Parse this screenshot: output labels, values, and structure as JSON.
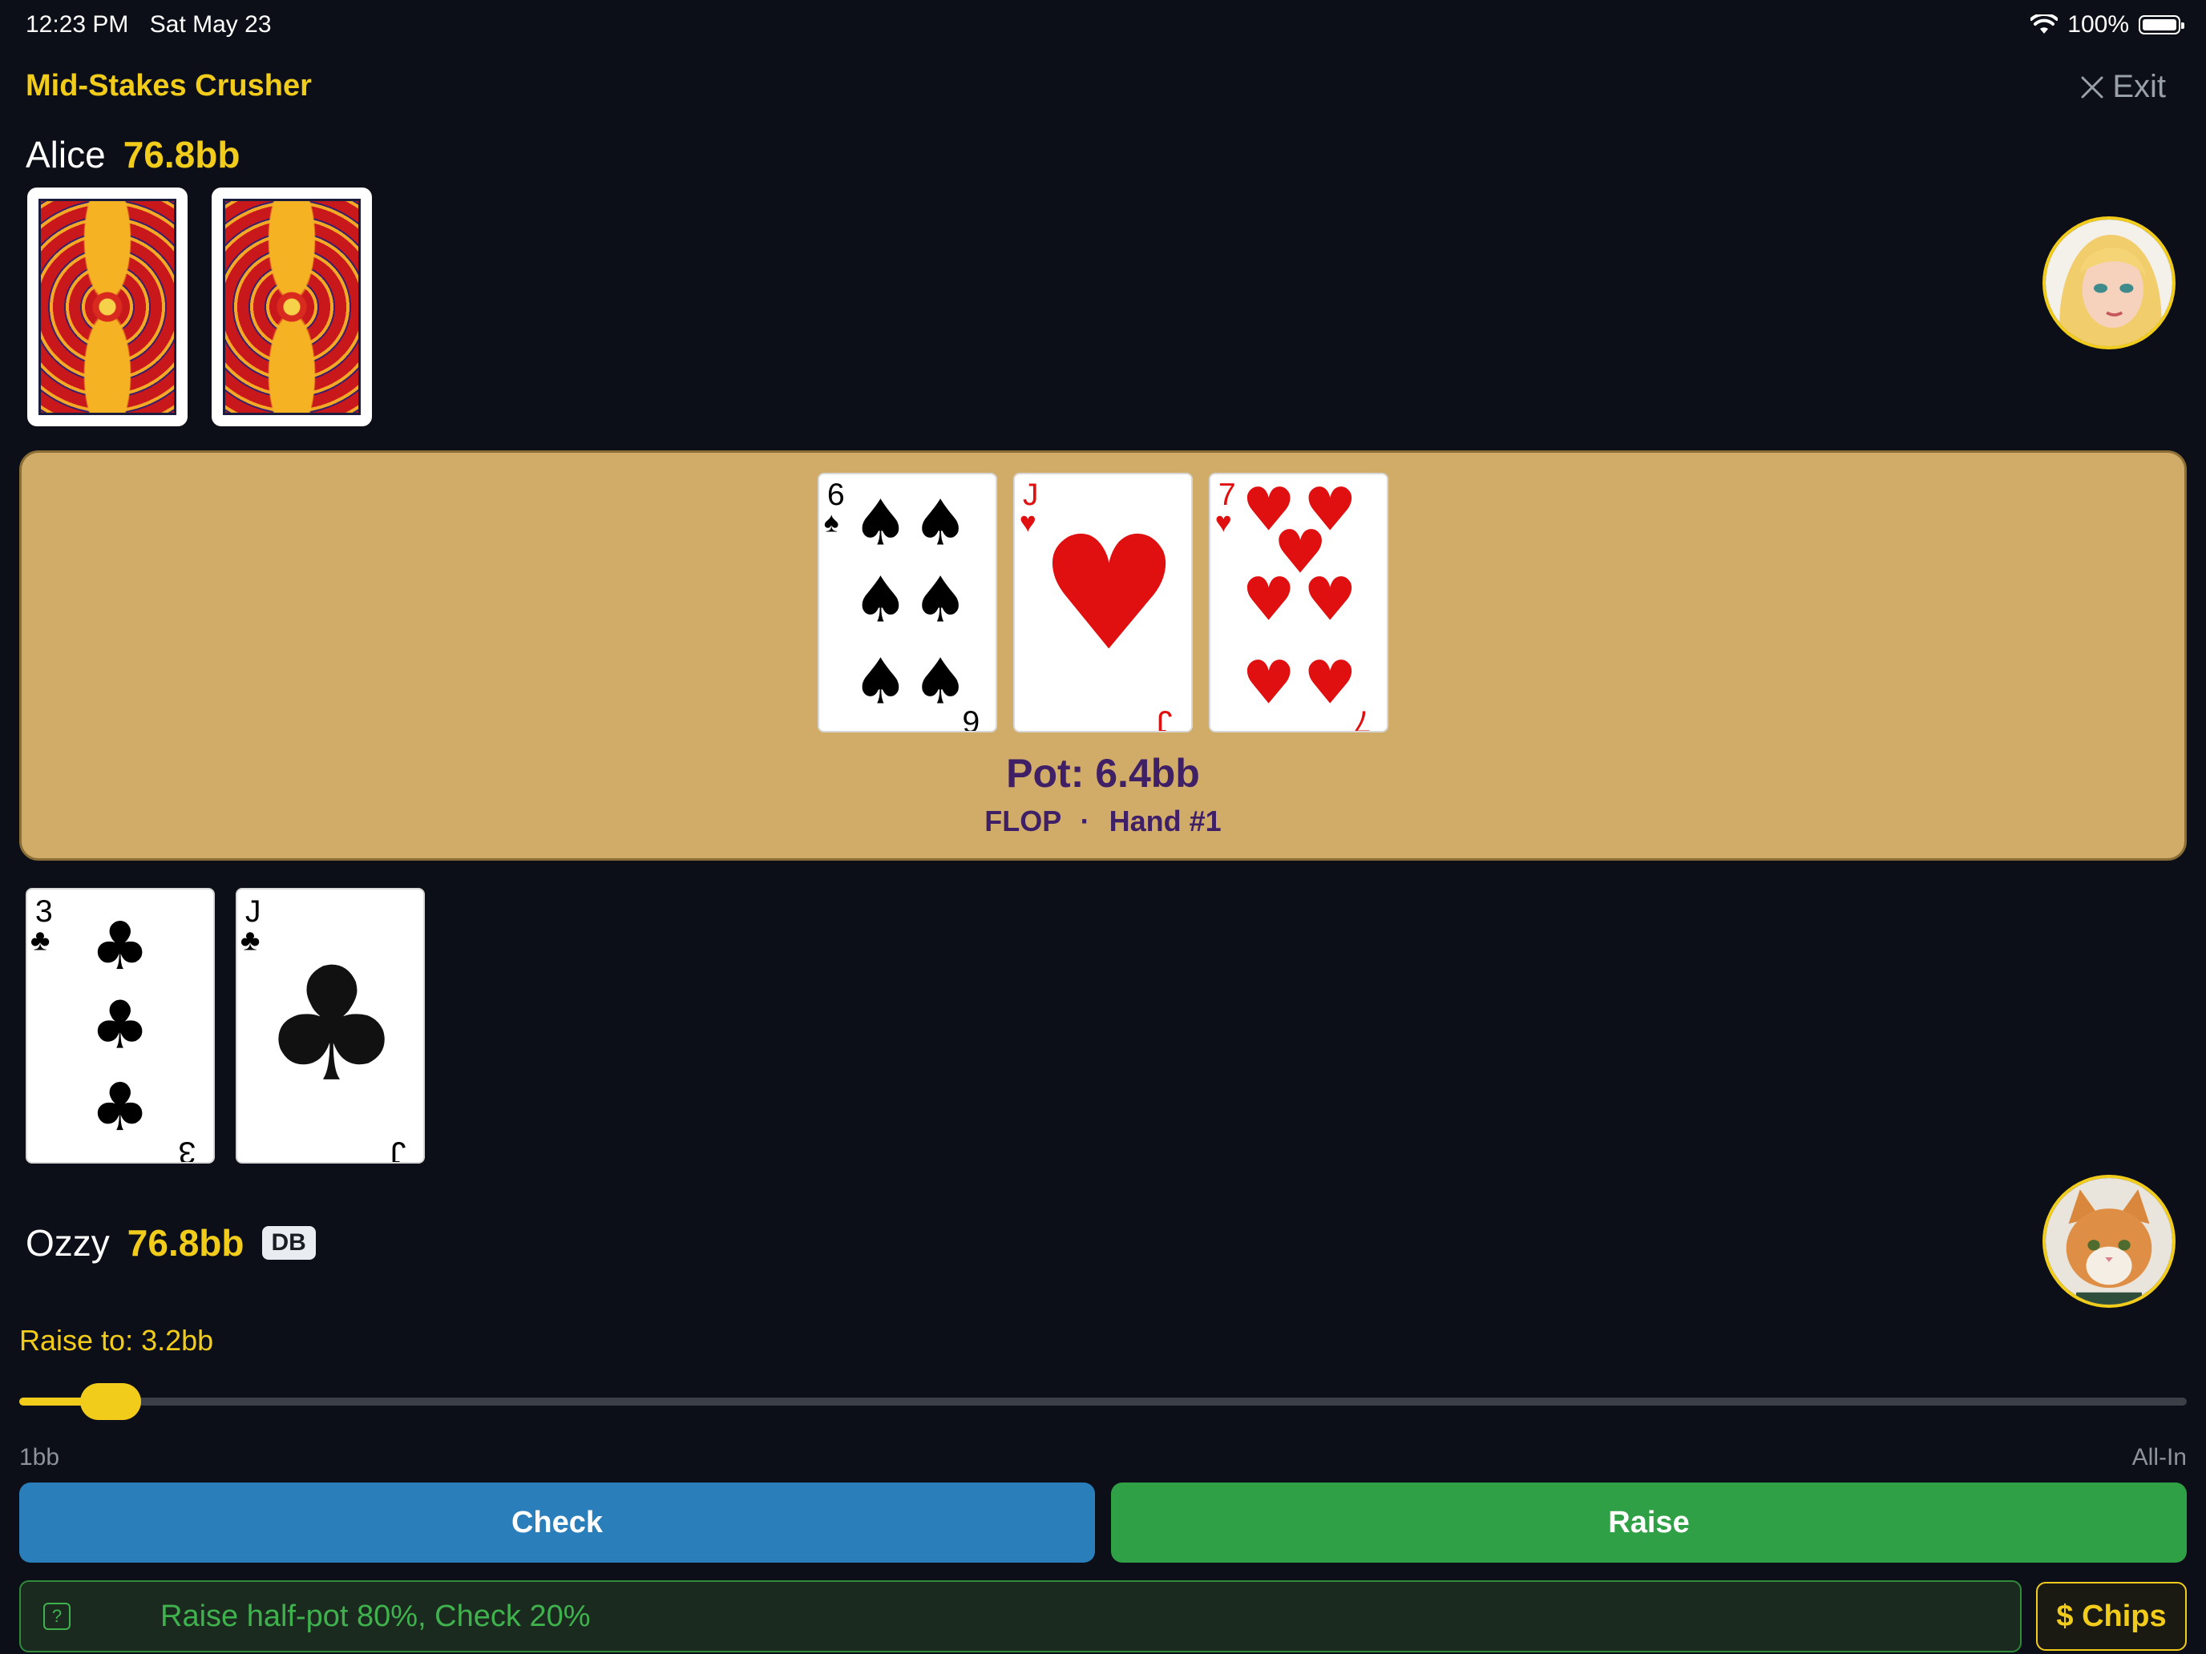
{
  "status_bar": {
    "time": "12:23 PM",
    "date": "Sat May 23",
    "battery": "100%",
    "wifi_icon": "wifi-icon",
    "battery_icon": "battery-icon"
  },
  "header": {
    "title": "Mid-Stakes Crusher",
    "exit_label": "Exit",
    "exit_icon": "close-icon"
  },
  "opponent": {
    "name": "Alice",
    "stack": "76.8bb",
    "avatar": "alice-avatar",
    "hole_cards": [
      "back",
      "back"
    ]
  },
  "board": {
    "cards": [
      {
        "rank": "6",
        "suit": "♠",
        "color": "#000000"
      },
      {
        "rank": "J",
        "suit": "♥",
        "color": "#e01010"
      },
      {
        "rank": "7",
        "suit": "♥",
        "color": "#e01010"
      }
    ],
    "pot": "Pot: 6.4bb",
    "street": "FLOP",
    "separator": "·",
    "hand": "Hand #1"
  },
  "hero": {
    "name": "Ozzy",
    "stack": "76.8bb",
    "badge": "DB",
    "avatar": "ozzy-avatar",
    "hole_cards": [
      {
        "rank": "3",
        "suit": "♣",
        "color": "#000000"
      },
      {
        "rank": "J",
        "suit": "♣",
        "color": "#000000"
      }
    ]
  },
  "raise": {
    "label": "Raise to: 3.2bb",
    "min_label": "1bb",
    "max_label": "All-In",
    "slider_fraction": 0.03
  },
  "actions": {
    "check_label": "Check",
    "raise_label": "Raise"
  },
  "advice": {
    "icon": "help-icon",
    "text": "Raise half-pot 80%, Check 20%"
  },
  "chips_label": "$ Chips",
  "colors": {
    "accent": "#f2cc1b",
    "board": "#d1ac69",
    "check": "#2a7fbb",
    "raise": "#2fa046",
    "pot_text": "#3f1f66"
  }
}
